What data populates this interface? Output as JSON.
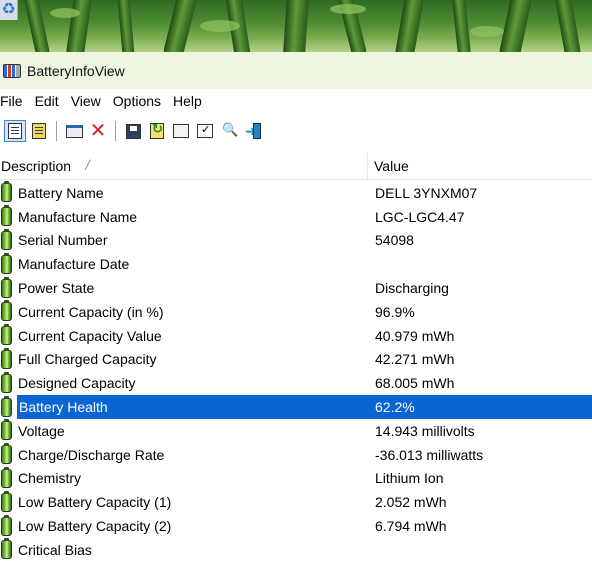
{
  "window": {
    "title": "BatteryInfoView"
  },
  "menu": [
    "File",
    "Edit",
    "View",
    "Options",
    "Help"
  ],
  "toolbar": {
    "icons": [
      "html-report-icon",
      "text-report-icon",
      "options-icon",
      "delete-icon",
      "save-icon",
      "refresh-icon",
      "copy-icon",
      "properties-icon",
      "find-icon",
      "exit-icon"
    ]
  },
  "list": {
    "columns": {
      "description": "Description",
      "value": "Value"
    },
    "rows": [
      {
        "label": "Battery Name",
        "value": "DELL 3YNXM07"
      },
      {
        "label": "Manufacture Name",
        "value": "LGC-LGC4.47"
      },
      {
        "label": "Serial Number",
        "value": "54098"
      },
      {
        "label": "Manufacture Date",
        "value": ""
      },
      {
        "label": "Power State",
        "value": "Discharging"
      },
      {
        "label": "Current Capacity (in %)",
        "value": "96.9%"
      },
      {
        "label": "Current Capacity Value",
        "value": "40.979 mWh"
      },
      {
        "label": "Full Charged Capacity",
        "value": "42.271 mWh"
      },
      {
        "label": "Designed Capacity",
        "value": "68.005 mWh"
      },
      {
        "label": "Battery Health",
        "value": "62.2%",
        "selected": true
      },
      {
        "label": "Voltage",
        "value": "14.943 millivolts"
      },
      {
        "label": "Charge/Discharge Rate",
        "value": "-36.013 milliwatts"
      },
      {
        "label": "Chemistry",
        "value": "Lithium Ion"
      },
      {
        "label": "Low Battery Capacity (1)",
        "value": "2.052 mWh"
      },
      {
        "label": "Low Battery Capacity (2)",
        "value": "6.794 mWh"
      },
      {
        "label": "Critical Bias",
        "value": ""
      }
    ]
  },
  "colors": {
    "selection": "#0a64d2",
    "titlebar": "#eef5e2"
  }
}
